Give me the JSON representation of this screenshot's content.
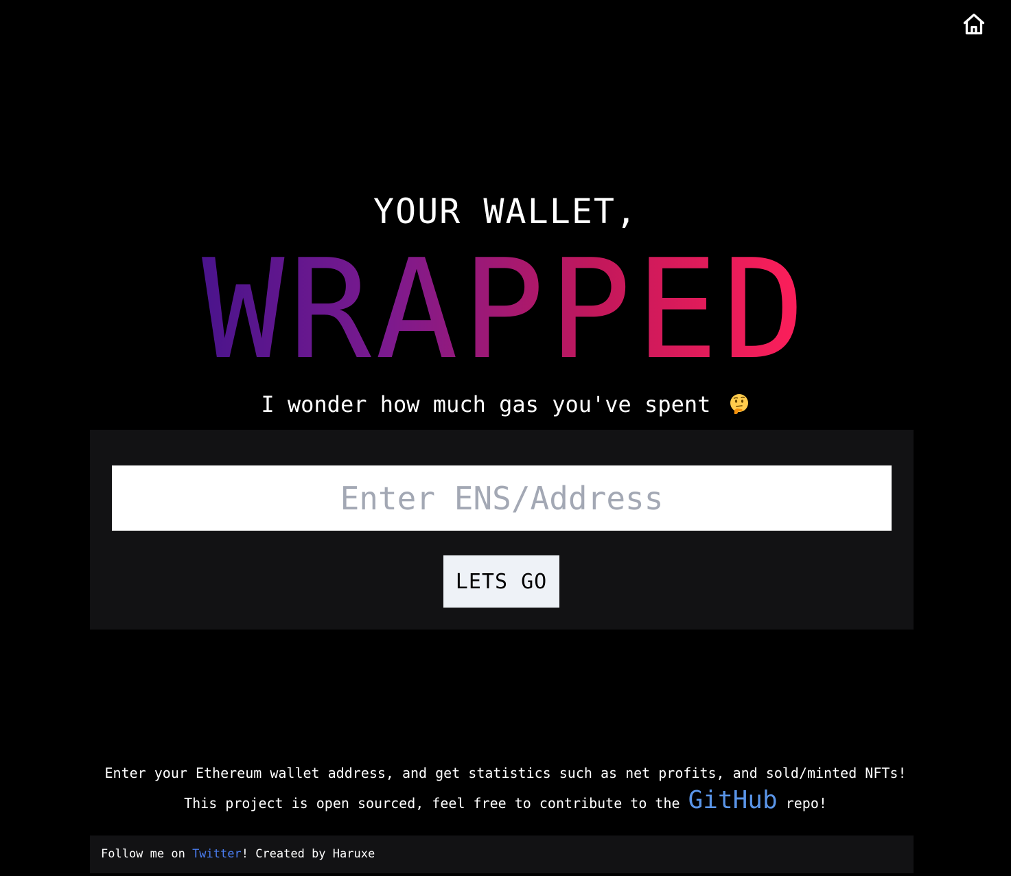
{
  "header": {
    "home_icon": "home-icon"
  },
  "hero": {
    "subtitle": "YOUR WALLET,",
    "title": "WRAPPED",
    "gradient_colors": [
      "#4a148c",
      "#7b1a8f",
      "#c2185b",
      "#ff1f5a"
    ],
    "tagline": "I wonder how much gas you've spent",
    "tagline_emoji": "thinking-face-icon"
  },
  "form": {
    "address_placeholder": "Enter ENS/Address",
    "address_value": "",
    "submit_label": "LETS GO"
  },
  "info": {
    "line1": "Enter your Ethereum wallet address, and get statistics such as net profits, and sold/minted NFTs!",
    "line2_before": "This project is open sourced, feel free to contribute to the ",
    "github_link": "GitHub",
    "line2_after": " repo!",
    "link_color": "#5a95e8"
  },
  "footer": {
    "text_before": "Follow me on ",
    "twitter_link": "Twitter",
    "text_after": "! Created by Haruxe"
  }
}
